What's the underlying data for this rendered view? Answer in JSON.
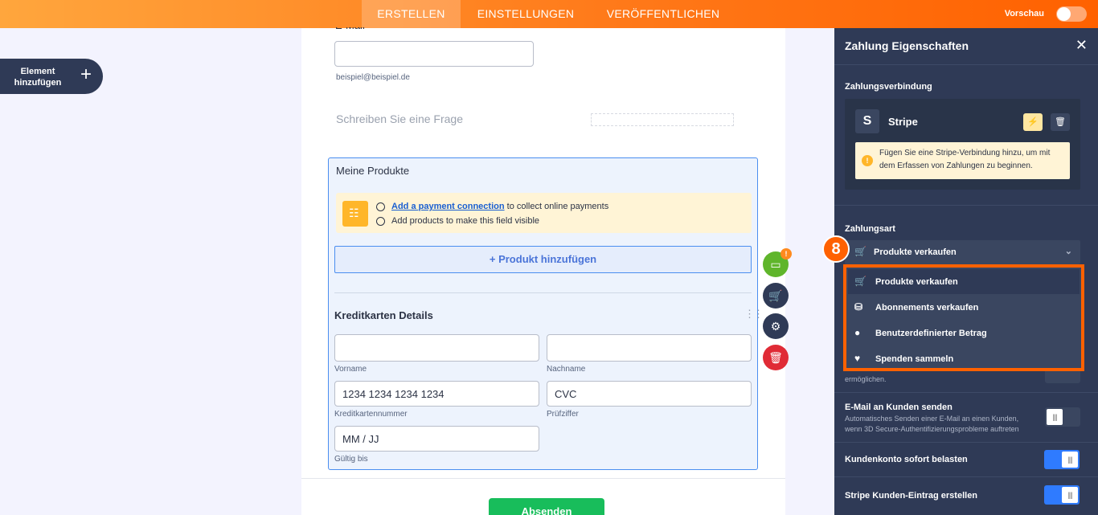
{
  "topbar": {
    "tabs": [
      "ERSTELLEN",
      "EINSTELLUNGEN",
      "VERÖFFENTLICHEN"
    ],
    "preview_label": "Vorschau"
  },
  "add_element": {
    "label": "Element hinzufügen"
  },
  "form": {
    "email_label": "E-Mail",
    "email_hint": "beispiel@beispiel.de",
    "question_placeholder": "Schreiben Sie eine Frage",
    "products": {
      "title": "Meine Produkte",
      "notice_link": "Add a payment connection",
      "notice_line1_rest": " to collect online payments",
      "notice_line2": "Add products to make this field visible",
      "add_button": "+ Produkt hinzufügen"
    },
    "card": {
      "title": "Kreditkarten Details",
      "firstname_label": "Vorname",
      "lastname_label": "Nachname",
      "number_value": "1234 1234 1234 1234",
      "number_label": "Kreditkartennummer",
      "cvc_value": "CVC",
      "cvc_label": "Prüfziffer",
      "expiry_value": "MM / JJ",
      "expiry_label": "Gültig bis"
    },
    "submit_label": "Absenden",
    "badge": "!"
  },
  "panel": {
    "title": "Zahlung Eigenschaften",
    "connection_heading": "Zahlungsverbindung",
    "provider_letter": "S",
    "provider_name": "Stripe",
    "warning": "Fügen Sie eine Stripe-Verbindung hinzu, um mit dem Erfassen von Zahlungen zu beginnen.",
    "payment_type_heading": "Zahlungsart",
    "payment_type_selected": "Produkte verkaufen",
    "dropdown_options": [
      "Produkte verkaufen",
      "Abonnements verkaufen",
      "Benutzerdefinierter Betrag",
      "Spenden sammeln"
    ],
    "partial_desc": "ermöglichen.",
    "email_customer": {
      "label": "E-Mail an Kunden senden",
      "desc1": "Automatisches Senden einer E-Mail an einen Kunden,",
      "desc2": "wenn 3D Secure-Authentifizierungsprobleme auftreten",
      "enabled": false
    },
    "charge_now": {
      "label": "Kundenkonto sofort belasten",
      "enabled": true
    },
    "create_customer": {
      "label": "Stripe Kunden-Eintrag erstellen",
      "enabled": true
    }
  },
  "step_marker": "8",
  "colors": {
    "accent": "#ff6100",
    "panel": "#2f3a56",
    "link": "#1a5fd1",
    "success": "#18bd5b",
    "toggle_on": "#2f7bff"
  }
}
